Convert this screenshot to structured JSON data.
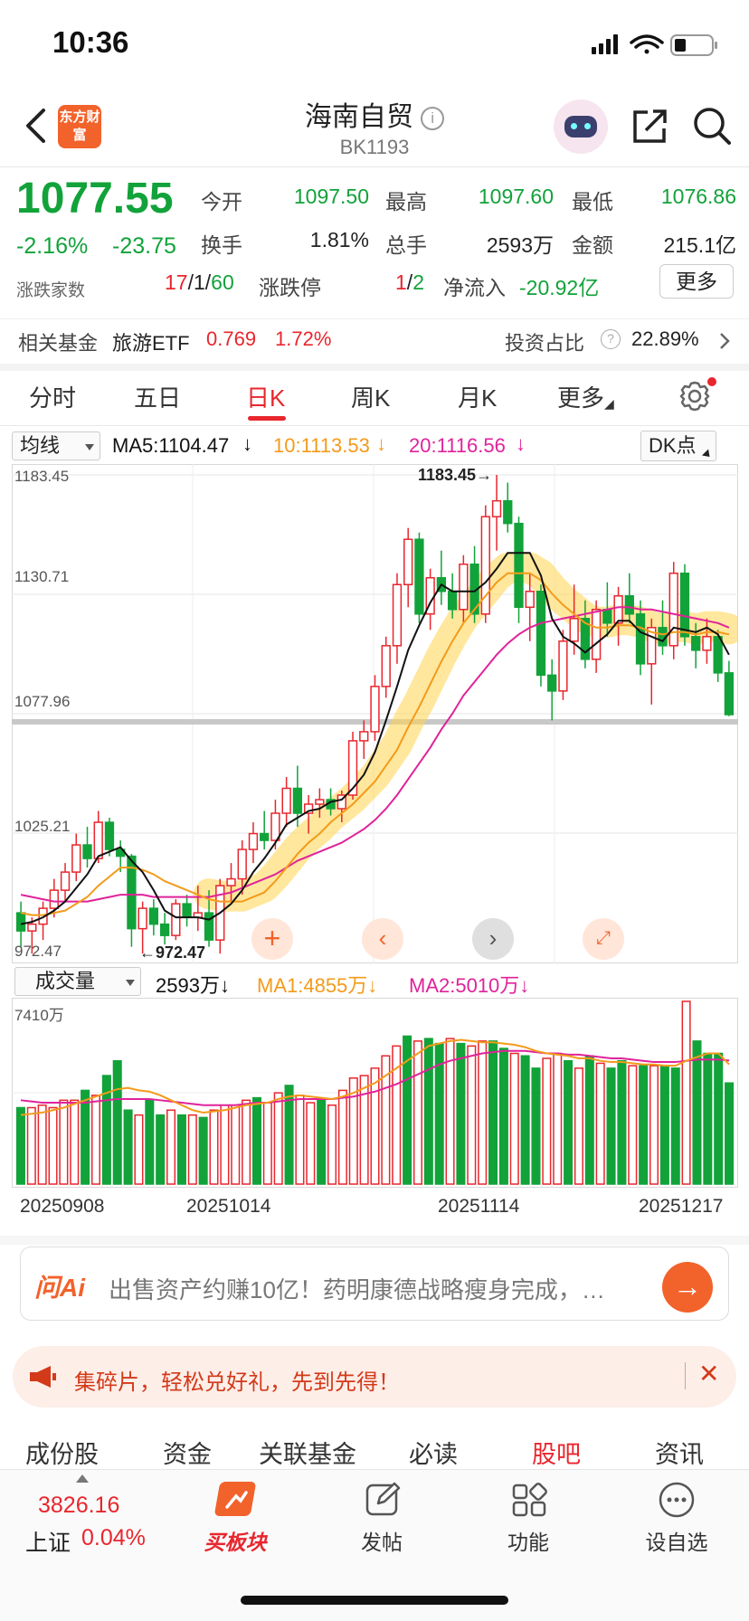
{
  "status": {
    "time": "10:36"
  },
  "header": {
    "title": "海南自贸",
    "code": "BK1193",
    "logo_text": "东方财富"
  },
  "quote": {
    "price": "1077.55",
    "change_pct": "-2.16%",
    "change": "-23.75",
    "open_label": "今开",
    "open": "1097.50",
    "high_label": "最高",
    "high": "1097.60",
    "low_label": "最低",
    "low": "1076.86",
    "turnover_label": "换手",
    "turnover": "1.81%",
    "volume_label": "总手",
    "volume": "2593万",
    "amount_label": "金额",
    "amount": "215.1亿",
    "updown_label": "涨跌家数",
    "up_count": "17",
    "flat_count": "1",
    "down_count": "60",
    "limit_label": "涨跌停",
    "limit_up": "1",
    "limit_down": "2",
    "netflow_label": "净流入",
    "netflow": "-20.92亿",
    "more_label": "更多"
  },
  "fund": {
    "label": "相关基金",
    "name": "旅游ETF",
    "price": "0.769",
    "pct": "1.72%",
    "ratio_label": "投资占比",
    "ratio": "22.89%"
  },
  "tabs": [
    "分时",
    "五日",
    "日K",
    "周K",
    "月K",
    "更多"
  ],
  "active_tab": 2,
  "ma": {
    "select": "均线",
    "ma5": "MA5:1104.47",
    "ma10": "10:1113.53",
    "ma20": "20:1116.56",
    "dk": "DK点"
  },
  "vol_ind": {
    "select": "成交量",
    "vol": "2593万",
    "ma1": "MA1:4855万",
    "ma2": "MA2:5010万",
    "max_label": "7410万"
  },
  "colors": {
    "up": "#e8262d",
    "down": "#12a23a",
    "ma5": "#111111",
    "ma10": "#f39b1b",
    "ma20": "#e0239a",
    "accent": "#f2622b"
  },
  "chart_data": {
    "type": "candlestick",
    "y_ticks": [
      "1183.45",
      "1130.71",
      "1077.96",
      "1025.21",
      "972.47"
    ],
    "ylim": [
      972.47,
      1183.45
    ],
    "high_marker": "1183.45",
    "low_marker": "972.47",
    "x_labels": [
      "20250908",
      "20251014",
      "20251114",
      "20251217"
    ],
    "candles": [
      {
        "o": 990,
        "h": 995,
        "l": 975,
        "c": 982
      },
      {
        "o": 982,
        "h": 988,
        "l": 972,
        "c": 985
      },
      {
        "o": 985,
        "h": 995,
        "l": 978,
        "c": 992
      },
      {
        "o": 992,
        "h": 1005,
        "l": 988,
        "c": 1000
      },
      {
        "o": 1000,
        "h": 1012,
        "l": 995,
        "c": 1008
      },
      {
        "o": 1008,
        "h": 1025,
        "l": 1004,
        "c": 1020
      },
      {
        "o": 1020,
        "h": 1028,
        "l": 1010,
        "c": 1014
      },
      {
        "o": 1014,
        "h": 1035,
        "l": 1012,
        "c": 1030
      },
      {
        "o": 1030,
        "h": 1032,
        "l": 1015,
        "c": 1018
      },
      {
        "o": 1018,
        "h": 1022,
        "l": 1008,
        "c": 1015
      },
      {
        "o": 1015,
        "h": 1016,
        "l": 975,
        "c": 983
      },
      {
        "o": 983,
        "h": 995,
        "l": 972,
        "c": 992
      },
      {
        "o": 992,
        "h": 996,
        "l": 980,
        "c": 985
      },
      {
        "o": 985,
        "h": 990,
        "l": 976,
        "c": 980
      },
      {
        "o": 980,
        "h": 996,
        "l": 978,
        "c": 994
      },
      {
        "o": 994,
        "h": 998,
        "l": 984,
        "c": 988
      },
      {
        "o": 988,
        "h": 1002,
        "l": 982,
        "c": 990
      },
      {
        "o": 990,
        "h": 1000,
        "l": 975,
        "c": 978
      },
      {
        "o": 978,
        "h": 1005,
        "l": 972,
        "c": 1002
      },
      {
        "o": 1002,
        "h": 1012,
        "l": 995,
        "c": 1005
      },
      {
        "o": 1005,
        "h": 1022,
        "l": 998,
        "c": 1018
      },
      {
        "o": 1018,
        "h": 1030,
        "l": 1012,
        "c": 1025
      },
      {
        "o": 1025,
        "h": 1035,
        "l": 1018,
        "c": 1022
      },
      {
        "o": 1022,
        "h": 1040,
        "l": 1018,
        "c": 1034
      },
      {
        "o": 1034,
        "h": 1050,
        "l": 1028,
        "c": 1045
      },
      {
        "o": 1045,
        "h": 1055,
        "l": 1028,
        "c": 1034
      },
      {
        "o": 1034,
        "h": 1042,
        "l": 1025,
        "c": 1038
      },
      {
        "o": 1038,
        "h": 1045,
        "l": 1032,
        "c": 1040
      },
      {
        "o": 1040,
        "h": 1045,
        "l": 1033,
        "c": 1036
      },
      {
        "o": 1036,
        "h": 1044,
        "l": 1030,
        "c": 1042
      },
      {
        "o": 1042,
        "h": 1070,
        "l": 1040,
        "c": 1066
      },
      {
        "o": 1066,
        "h": 1075,
        "l": 1058,
        "c": 1070
      },
      {
        "o": 1070,
        "h": 1095,
        "l": 1066,
        "c": 1090
      },
      {
        "o": 1090,
        "h": 1112,
        "l": 1085,
        "c": 1108
      },
      {
        "o": 1108,
        "h": 1140,
        "l": 1100,
        "c": 1135
      },
      {
        "o": 1135,
        "h": 1160,
        "l": 1125,
        "c": 1155
      },
      {
        "o": 1155,
        "h": 1158,
        "l": 1118,
        "c": 1122
      },
      {
        "o": 1122,
        "h": 1142,
        "l": 1115,
        "c": 1138
      },
      {
        "o": 1138,
        "h": 1150,
        "l": 1126,
        "c": 1132
      },
      {
        "o": 1132,
        "h": 1140,
        "l": 1120,
        "c": 1124
      },
      {
        "o": 1124,
        "h": 1148,
        "l": 1118,
        "c": 1144
      },
      {
        "o": 1144,
        "h": 1152,
        "l": 1118,
        "c": 1122
      },
      {
        "o": 1122,
        "h": 1170,
        "l": 1118,
        "c": 1165
      },
      {
        "o": 1165,
        "h": 1183.45,
        "l": 1150,
        "c": 1172
      },
      {
        "o": 1172,
        "h": 1180,
        "l": 1158,
        "c": 1162
      },
      {
        "o": 1162,
        "h": 1165,
        "l": 1118,
        "c": 1125
      },
      {
        "o": 1125,
        "h": 1140,
        "l": 1110,
        "c": 1132
      },
      {
        "o": 1132,
        "h": 1135,
        "l": 1090,
        "c": 1095
      },
      {
        "o": 1095,
        "h": 1102,
        "l": 1075,
        "c": 1088
      },
      {
        "o": 1088,
        "h": 1115,
        "l": 1084,
        "c": 1110
      },
      {
        "o": 1110,
        "h": 1135,
        "l": 1104,
        "c": 1120
      },
      {
        "o": 1120,
        "h": 1128,
        "l": 1098,
        "c": 1102
      },
      {
        "o": 1102,
        "h": 1128,
        "l": 1096,
        "c": 1124
      },
      {
        "o": 1124,
        "h": 1136,
        "l": 1112,
        "c": 1118
      },
      {
        "o": 1118,
        "h": 1134,
        "l": 1108,
        "c": 1130
      },
      {
        "o": 1130,
        "h": 1140,
        "l": 1118,
        "c": 1122
      },
      {
        "o": 1122,
        "h": 1128,
        "l": 1095,
        "c": 1100
      },
      {
        "o": 1100,
        "h": 1120,
        "l": 1082,
        "c": 1116
      },
      {
        "o": 1116,
        "h": 1128,
        "l": 1104,
        "c": 1108
      },
      {
        "o": 1108,
        "h": 1145,
        "l": 1102,
        "c": 1140
      },
      {
        "o": 1140,
        "h": 1144,
        "l": 1108,
        "c": 1112
      },
      {
        "o": 1112,
        "h": 1118,
        "l": 1098,
        "c": 1106
      },
      {
        "o": 1106,
        "h": 1120,
        "l": 1100,
        "c": 1112
      },
      {
        "o": 1112,
        "h": 1115,
        "l": 1092,
        "c": 1096
      },
      {
        "o": 1096,
        "h": 1101.3,
        "l": 1076.86,
        "c": 1077.55
      }
    ],
    "ma5": [
      985,
      986,
      988,
      991,
      995,
      1001,
      1007,
      1015,
      1017,
      1019,
      1013,
      1008,
      1000,
      991,
      988,
      988,
      988,
      987,
      990,
      994,
      1000,
      1008,
      1014,
      1021,
      1029,
      1032,
      1035,
      1036,
      1039,
      1040,
      1045,
      1051,
      1061,
      1075,
      1090,
      1106,
      1117,
      1127,
      1135,
      1132,
      1132,
      1132,
      1136,
      1142,
      1149,
      1149,
      1149,
      1139,
      1120,
      1112,
      1109,
      1105,
      1109,
      1113,
      1119,
      1119,
      1114,
      1112,
      1110,
      1116,
      1115,
      1114,
      1116,
      1113,
      1104
    ],
    "ma10": [
      990,
      989,
      989,
      990,
      991,
      994,
      997,
      1002,
      1006,
      1010,
      1010,
      1009,
      1007,
      1004,
      1002,
      1000,
      998,
      996,
      995,
      995,
      995,
      997,
      999,
      1004,
      1010,
      1016,
      1021,
      1025,
      1030,
      1034,
      1038,
      1043,
      1048,
      1055,
      1062,
      1072,
      1081,
      1091,
      1101,
      1110,
      1118,
      1124,
      1130,
      1136,
      1140,
      1140,
      1140,
      1137,
      1131,
      1126,
      1122,
      1118,
      1116,
      1116,
      1117,
      1117,
      1116,
      1114,
      1113,
      1114,
      1114,
      1113,
      1114,
      1114,
      1113
    ],
    "ma20": [
      998,
      997,
      996,
      995,
      995,
      995,
      995,
      996,
      997,
      998,
      998,
      998,
      997,
      997,
      997,
      997,
      997,
      997,
      998,
      999,
      1001,
      1003,
      1005,
      1007,
      1010,
      1013,
      1015,
      1017,
      1019,
      1021,
      1024,
      1027,
      1031,
      1036,
      1042,
      1049,
      1056,
      1063,
      1071,
      1078,
      1086,
      1092,
      1098,
      1104,
      1109,
      1113,
      1116,
      1118,
      1119,
      1120,
      1121,
      1122,
      1123,
      1124,
      1125,
      1125,
      1124,
      1124,
      1123,
      1122,
      1121,
      1120,
      1119,
      1118,
      1116
    ]
  },
  "volume_data": {
    "ylim": [
      0,
      7410
    ],
    "values": [
      3100,
      3100,
      3200,
      3100,
      3400,
      3400,
      3800,
      3600,
      4400,
      5000,
      3000,
      2800,
      3400,
      2800,
      3000,
      2800,
      2800,
      2700,
      3000,
      3200,
      3200,
      3400,
      3500,
      3300,
      3700,
      4000,
      3600,
      3300,
      3400,
      3200,
      3800,
      4300,
      4400,
      4700,
      5200,
      5600,
      6000,
      5800,
      5900,
      5700,
      5900,
      5700,
      5600,
      5800,
      5800,
      5500,
      5300,
      5200,
      4700,
      5100,
      5300,
      5000,
      4700,
      5200,
      4900,
      4700,
      5000,
      4800,
      4800,
      4800,
      4800,
      4700,
      7410,
      5800,
      5300,
      5300,
      4100
    ],
    "ma1": [
      2800,
      2850,
      2900,
      3000,
      3100,
      3250,
      3400,
      3550,
      3700,
      3850,
      3900,
      3800,
      3750,
      3600,
      3400,
      3200,
      3000,
      2900,
      2950,
      3000,
      3100,
      3200,
      3250,
      3300,
      3450,
      3550,
      3600,
      3550,
      3500,
      3450,
      3550,
      3700,
      3900,
      4100,
      4400,
      4700,
      5000,
      5300,
      5600,
      5700,
      5800,
      5850,
      5800,
      5750,
      5750,
      5700,
      5650,
      5550,
      5400,
      5300,
      5250,
      5200,
      5100,
      5100,
      5000,
      4950,
      4950,
      4900,
      4850,
      4850,
      4800,
      4800,
      5000,
      5150,
      5300,
      5300,
      4855
    ],
    "ma2": [
      3400,
      3350,
      3300,
      3300,
      3300,
      3300,
      3300,
      3350,
      3400,
      3450,
      3450,
      3450,
      3450,
      3400,
      3350,
      3300,
      3250,
      3200,
      3200,
      3200,
      3200,
      3250,
      3300,
      3300,
      3350,
      3400,
      3450,
      3450,
      3450,
      3450,
      3500,
      3550,
      3650,
      3750,
      3900,
      4050,
      4250,
      4450,
      4650,
      4850,
      5000,
      5100,
      5200,
      5300,
      5350,
      5400,
      5400,
      5400,
      5350,
      5300,
      5300,
      5250,
      5250,
      5200,
      5150,
      5100,
      5100,
      5050,
      5000,
      4950,
      4950,
      4950,
      5000,
      5050,
      5050,
      5050,
      5010
    ]
  },
  "ai": {
    "logo": "问Ai",
    "text": "出售资产约赚10亿！药明康德战略瘦身完成，…"
  },
  "promo": {
    "text": "集碎片，轻松兑好礼，先到先得！"
  },
  "subtabs": [
    "成份股",
    "资金",
    "关联基金",
    "必读",
    "股吧",
    "资讯"
  ],
  "active_subtab": 4,
  "bottom_nav": {
    "index_value": "3826.16",
    "index_name": "上证",
    "index_pct": "0.04%",
    "items": [
      "买板块",
      "发帖",
      "功能",
      "设自选"
    ]
  }
}
